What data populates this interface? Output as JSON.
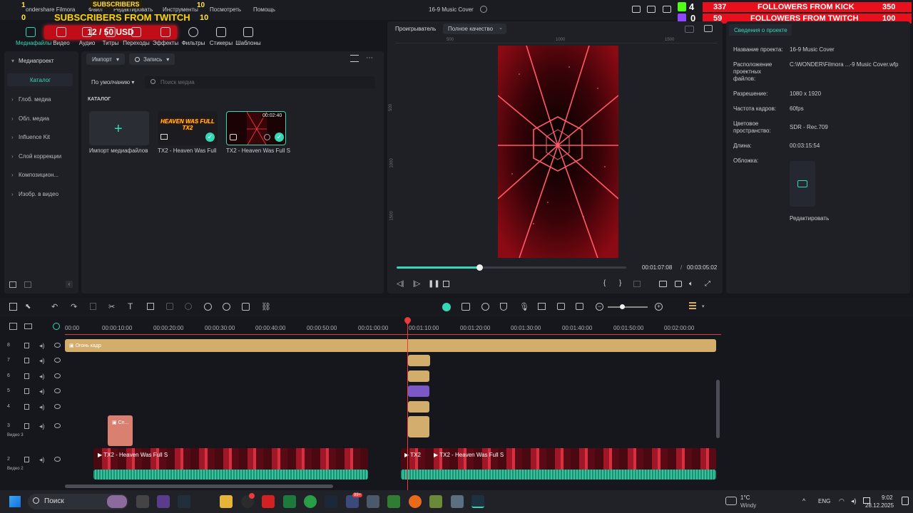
{
  "app": {
    "name_partial": "ondershare Filmora",
    "project_title": "16-9 Music Cover"
  },
  "menus": [
    "Файл",
    "Редактировать",
    "Инструменты",
    "Посмотреть",
    "Помощь"
  ],
  "overlay": {
    "subs_top_num": "1",
    "subs_top_label": "SUBSCRIBERS",
    "subs_top_right": "10",
    "subs_left_num": "0",
    "subs_main": "SUBSCRIBERS FROM TWITCH",
    "subs_main_right": "10",
    "goal": "12 / 50 USD",
    "kick_num": "4",
    "kick_count": "337",
    "kick_label": "FOLLOWERS FROM KICK",
    "kick_goal": "350",
    "twitch_num": "0",
    "twitch_count": "59",
    "twitch_label": "FOLLOWERS FROM TWITCH",
    "twitch_goal": "100"
  },
  "toolbar": [
    "Медиафайлы",
    "Видео",
    "Аудио",
    "Титры",
    "Переходы",
    "Эффекты",
    "Фильтры",
    "Стикеры",
    "Шаблоны"
  ],
  "sidebar": {
    "header": "Медиапроект",
    "catalog": "Каталог",
    "items": [
      "Глоб. медиа",
      "Обл. медиа",
      "Influence Kit",
      "Слой коррекции",
      "Композицион...",
      "Изобр. в видео"
    ]
  },
  "media": {
    "import_btn": "Импорт",
    "record_btn": "Запись",
    "sort": "По умолчанию",
    "search_placeholder": "Поиск медиа",
    "section": "КАТАЛОГ",
    "items": [
      {
        "label": "Импорт медиафайлов"
      },
      {
        "label": "TX2 - Heaven Was Full",
        "thumb_text": "HEAVEN WAS FULL TX2"
      },
      {
        "label": "TX2 - Heaven Was Full S",
        "duration": "00:02:40"
      }
    ]
  },
  "player": {
    "label": "Проигрыватель",
    "quality": "Полное качество",
    "current": "00:01:07:08",
    "sep": "/",
    "total": "00:03:05:02",
    "progress": 0.36,
    "ruler": [
      "500",
      "1000",
      "1500"
    ],
    "vruler": [
      "500",
      "1000",
      "1500"
    ]
  },
  "properties": {
    "tab": "Сведения о проекте",
    "rows": [
      {
        "k": "Название проекта:",
        "v": "16-9 Music Cover"
      },
      {
        "k": "Расположение проектных файлов:",
        "v": "C:\\WONDER\\Filmora ...-9 Music Cover.wfp"
      },
      {
        "k": "Разрешение:",
        "v": "1080 x 1920"
      },
      {
        "k": "Частота кадров:",
        "v": "60fps"
      },
      {
        "k": "Цветовое пространство:",
        "v": "SDR - Rec.709"
      },
      {
        "k": "Длина:",
        "v": "00:03:15:54"
      },
      {
        "k": "Обложка:",
        "v": ""
      }
    ],
    "edit": "Редактировать"
  },
  "timeline": {
    "ticks": [
      "00:00",
      "00:00:10:00",
      "00:00:20:00",
      "00:00:30:00",
      "00:00:40:00",
      "00:00:50:00",
      "00:01:00:00",
      "00:01:10:00",
      "00:01:20:00",
      "00:01:30:00",
      "00:01:40:00",
      "00:01:50:00",
      "00:02:00:00"
    ],
    "tracks": [
      "8",
      "7",
      "6",
      "5",
      "4",
      "3",
      "2"
    ],
    "track3_name": "Видео 3",
    "track2_name": "Видео 2",
    "clip_top": "Огонь кадр",
    "clip_sp": "Сп...",
    "clip_main_a": "TX2 - Heaven Was Full S",
    "clip_main_b": "TX2 - Heaven Was Full S",
    "clip_main_b_prefix": "TX2"
  },
  "taskbar": {
    "search": "Поиск",
    "weather_temp": "1°C",
    "weather_desc": "Windy",
    "lang": "ENG",
    "time": "9:02",
    "date": "28.12.2025",
    "badge": "99+"
  },
  "colors": {
    "accent": "#35d7b5",
    "kick": "#53fc18",
    "twitch": "#9146ff",
    "overlay_red": "#e8101c",
    "gold": "#d2ad6b"
  }
}
